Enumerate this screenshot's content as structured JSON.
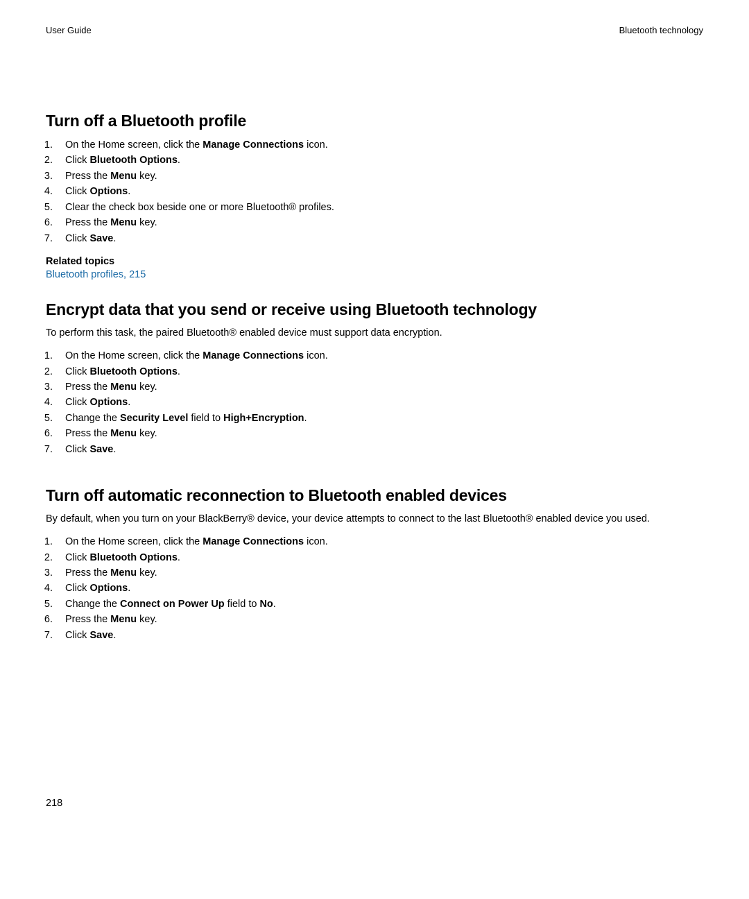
{
  "header": {
    "left": "User Guide",
    "right": "Bluetooth technology"
  },
  "page_number": "218",
  "section1": {
    "heading": "Turn off a Bluetooth profile",
    "steps": [
      {
        "pre": "On the Home screen, click the ",
        "bold": "Manage Connections",
        "post": " icon."
      },
      {
        "pre": "Click ",
        "bold": "Bluetooth Options",
        "post": "."
      },
      {
        "pre": "Press the ",
        "bold": "Menu",
        "post": " key."
      },
      {
        "pre": "Click ",
        "bold": "Options",
        "post": "."
      },
      {
        "pre": "Clear the check box beside one or more Bluetooth® profiles.",
        "bold": "",
        "post": ""
      },
      {
        "pre": "Press the ",
        "bold": "Menu",
        "post": " key."
      },
      {
        "pre": "Click ",
        "bold": "Save",
        "post": "."
      }
    ],
    "related_label": "Related topics",
    "related_link": "Bluetooth profiles, 215"
  },
  "section2": {
    "heading": "Encrypt data that you send or receive using Bluetooth technology",
    "intro": "To perform this task, the paired Bluetooth® enabled device must support data encryption.",
    "steps": [
      {
        "pre": "On the Home screen, click the ",
        "bold": "Manage Connections",
        "post": " icon."
      },
      {
        "pre": "Click ",
        "bold": "Bluetooth Options",
        "post": "."
      },
      {
        "pre": "Press the ",
        "bold": "Menu",
        "post": " key."
      },
      {
        "pre": "Click ",
        "bold": "Options",
        "post": "."
      },
      {
        "pre": "Change the ",
        "bold": "Security Level",
        "post_mid": " field to ",
        "bold2": "High+Encryption",
        "post": "."
      },
      {
        "pre": "Press the ",
        "bold": "Menu",
        "post": " key."
      },
      {
        "pre": "Click ",
        "bold": "Save",
        "post": "."
      }
    ]
  },
  "section3": {
    "heading": "Turn off automatic reconnection to Bluetooth enabled devices",
    "intro": "By default, when you turn on your BlackBerry® device, your device attempts to connect to the last Bluetooth® enabled device you used.",
    "steps": [
      {
        "pre": "On the Home screen, click the ",
        "bold": "Manage Connections",
        "post": " icon."
      },
      {
        "pre": "Click ",
        "bold": "Bluetooth Options",
        "post": "."
      },
      {
        "pre": "Press the ",
        "bold": "Menu",
        "post": " key."
      },
      {
        "pre": "Click ",
        "bold": "Options",
        "post": "."
      },
      {
        "pre": "Change the ",
        "bold": "Connect on Power Up",
        "post_mid": " field to ",
        "bold2": "No",
        "post": "."
      },
      {
        "pre": "Press the ",
        "bold": "Menu",
        "post": " key."
      },
      {
        "pre": "Click ",
        "bold": "Save",
        "post": "."
      }
    ]
  }
}
